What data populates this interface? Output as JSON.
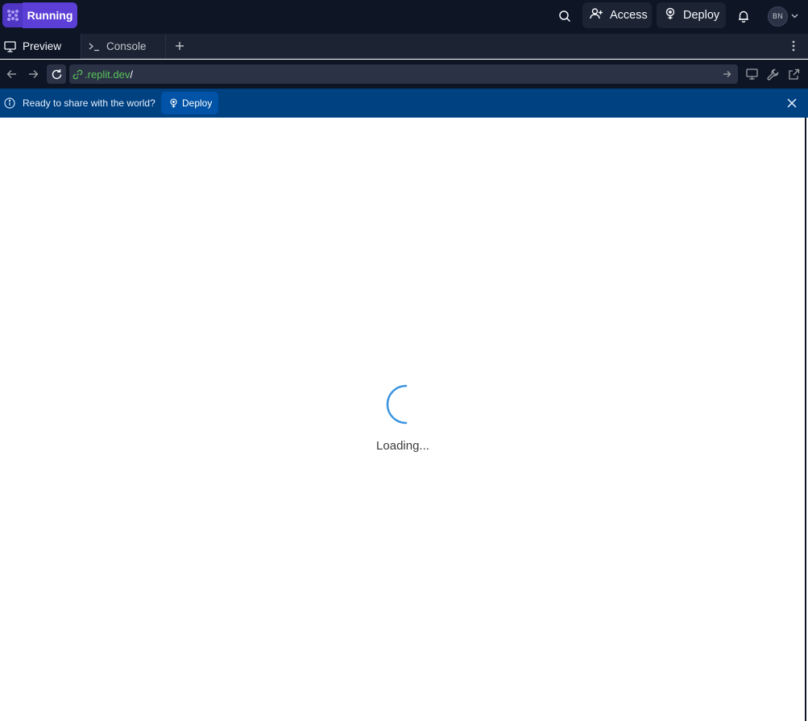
{
  "topbar": {
    "run_label": "Running",
    "access_label": "Access",
    "deploy_label": "Deploy",
    "avatar_initials": "BN",
    "icons": [
      "replit-logo-icon",
      "search-icon",
      "user-plus-icon",
      "deploy-icon",
      "bell-icon",
      "chevron-down-icon"
    ]
  },
  "tabs": [
    {
      "label": "Preview",
      "icon": "monitor-icon",
      "active": true
    },
    {
      "label": "Console",
      "icon": "terminal-icon",
      "active": false
    }
  ],
  "urlbar": {
    "domain": ".replit.dev",
    "path": "/",
    "icons": [
      "back-arrow-icon",
      "forward-arrow-icon",
      "reload-icon",
      "link-icon",
      "go-arrow-icon",
      "monitor-icon",
      "wrench-icon",
      "external-link-icon"
    ]
  },
  "banner": {
    "message": "Ready to share with the world?",
    "deploy_label": "Deploy"
  },
  "preview": {
    "loading_text": "Loading..."
  },
  "colors": {
    "topbar_bg": "#0e1525",
    "run_button": "#5b3fd6",
    "banner_bg": "#004182",
    "url_domain": "#58c35a",
    "spinner": "#3b95e0"
  }
}
